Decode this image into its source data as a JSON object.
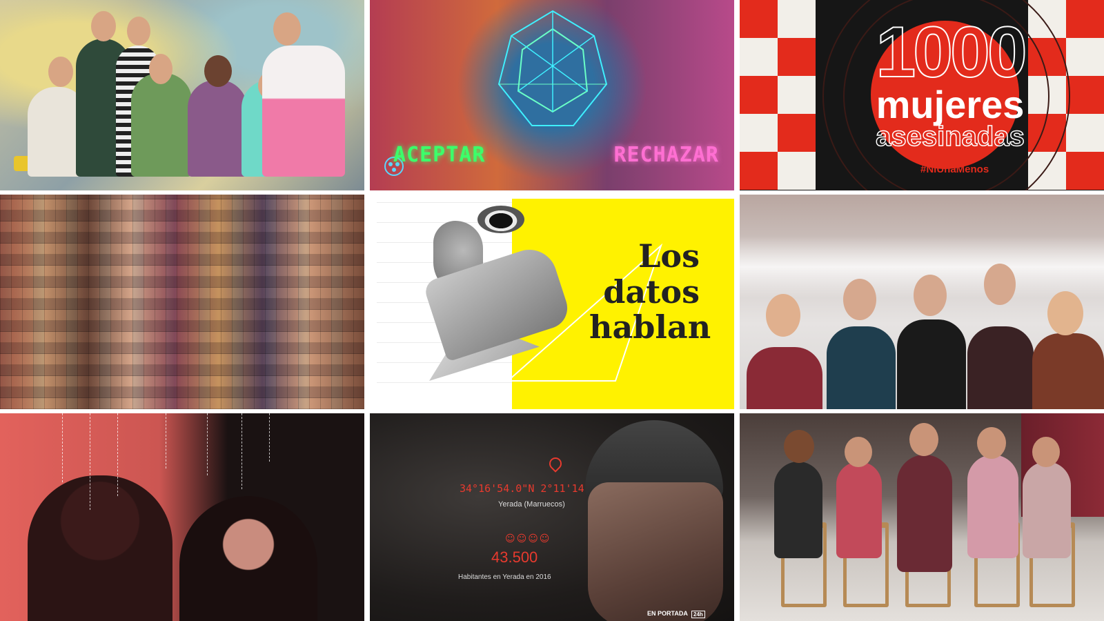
{
  "tiles": [
    {
      "id": "teen-cast-photo"
    },
    {
      "id": "neon-face-still",
      "left_label": "ACEPTAR",
      "right_label": "RECHAZAR"
    },
    {
      "id": "mil-mujeres-graphic",
      "number": "1000",
      "line1": "mujeres",
      "line2": "asesinadas",
      "hashtag": "#NiUnaMenos",
      "colors": {
        "accent": "#e32b1c",
        "background": "#161616"
      }
    },
    {
      "id": "faces-mosaic"
    },
    {
      "id": "los-datos-hablan",
      "title_line1": "Los",
      "title_line2": "datos",
      "title_line3": "hablan",
      "colors": {
        "accent": "#fff200"
      }
    },
    {
      "id": "blindfold-cast-photo"
    },
    {
      "id": "red-duotone-portraits"
    },
    {
      "id": "miner-portrait",
      "coordinates": "34°16'54.0\"N 2°11'14.0\"W",
      "place": "Yerada (Marruecos)",
      "population": "43.500",
      "population_label": "Habitantes en Yerada en 2016",
      "brand": "EN PORTADA",
      "logo": "24h"
    },
    {
      "id": "dancers-chairs-photo"
    }
  ]
}
